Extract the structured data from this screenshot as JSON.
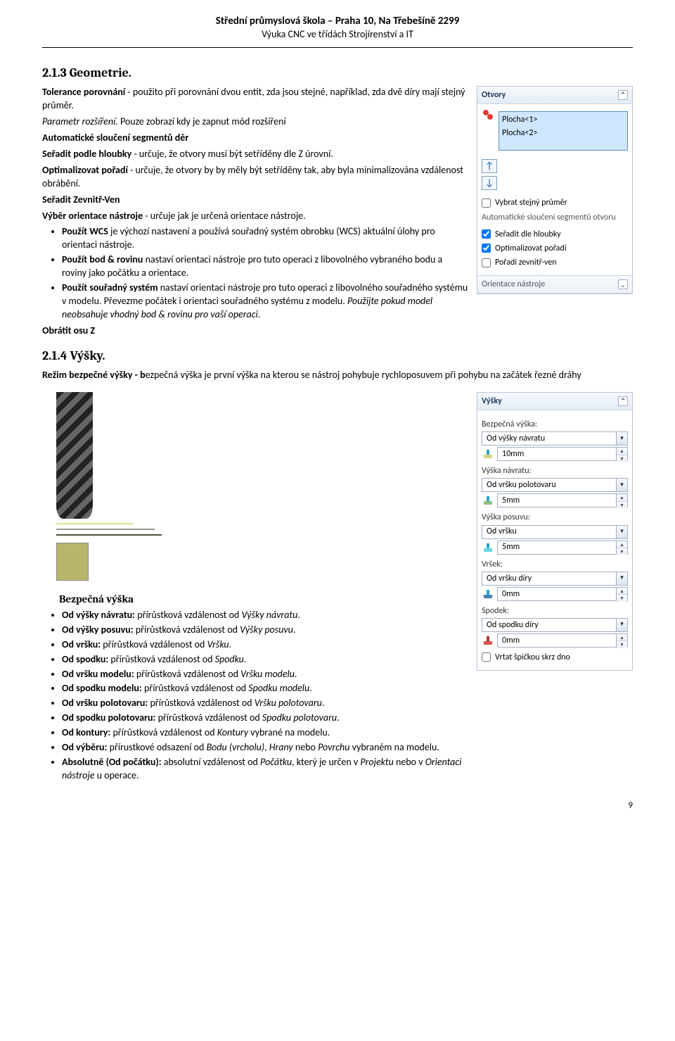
{
  "header": {
    "title": "Střední průmyslová škola – Praha 10, Na Třebešíně 2299",
    "subtitle": "Výuka CNC ve třídách Strojírenství a IT"
  },
  "section1": {
    "num": "2.1.3 Geometrie.",
    "p1a": "Tolerance porovnání",
    "p1b": " - použito při porovnání dvou entit, zda jsou stejné, například, zda dvě díry mají stejný průměr.",
    "p2a": "Parametr rozšíření.",
    "p2b": " Pouze zobrazí kdy je zapnut mód rozšíření",
    "p3": "Automatické sloučení segmentů děr",
    "p4a": "Seřadit podle hloubky",
    "p4b": " - určuje, že otvory musí být setříděny dle Z úrovní.",
    "p5a": "Optimalizovat pořadí",
    "p5b": " - určuje, že otvory by by měly být setříděny tak, aby byla minimalizována vzdálenost obrábění.",
    "p6": "Seřadit Zevnitř-Ven",
    "p7a": "Výběr orientace nástroje",
    "p7b": " - určuje jak je určená orientace nástroje.",
    "li1a": "Použít WCS",
    "li1b": " je výchozí nastavení a používá souřadný systém obrobku (WCS) aktuální úlohy pro orientaci nástroje.",
    "li2a": "Použít bod & rovinu",
    "li2b": " nastaví orientaci nástroje pro tuto operaci z libovolného vybraného bodu a roviny jako počátku a orientace.",
    "li3a": "Použít souřadný systém",
    "li3b": " nastaví orientaci nástroje pro tuto operaci z libovolného souřadného systému v modelu. Převezme počátek i orientaci souřadného systému z modelu. ",
    "li3c": "Použijte pokud model neobsahuje vhodný bod & rovinu pro vaší operaci",
    "li3d": ".",
    "p8": "Obrátit osu Z"
  },
  "panel1": {
    "title": "Otvory",
    "f1": "Plocha<1>",
    "f2": "Plocha<2>",
    "chk1": "Vybrat stejný průměr",
    "lbl1": "Automatické sloučení segmentů otvoru",
    "chk2": "Seřadit dle hloubky",
    "chk3": "Optimalizovat pořadí",
    "chk4": "Pořadí zevnitř-ven",
    "sub": "Orientace nástroje"
  },
  "section2": {
    "num": "2.1.4 Výšky.",
    "p1a": "Režim bezpečné výšky - b",
    "p1b": "ezpečná výška je první výška na kterou se nástroj pohybuje rychloposuvem při pohybu na začátek řezné dráhy",
    "h": "Bezpečná výška",
    "li1a": "Od výšky návratu:",
    "li1b": " přírůstková vzdálenost od ",
    "li1c": "Výšky návratu",
    "li1d": ".",
    "li2a": "Od výšky posuvu:",
    "li2b": " přírůstková vzdálenost od ",
    "li2c": "Výšky posuvu",
    "li2d": ".",
    "li3a": "Od vršku:",
    "li3b": " přírůstková vzdálenost od ",
    "li3c": "Vršku",
    "li3d": ".",
    "li4a": "Od spodku:",
    "li4b": " přírůstková vzdálenost od ",
    "li4c": "Spodku",
    "li4d": ".",
    "li5a": "Od vršku modelu:",
    "li5b": " přírůstková vzdálenost od ",
    "li5c": "Vršku modelu",
    "li5d": ".",
    "li6a": "Od spodku modelu:",
    "li6b": " přírůstková vzdálenost od ",
    "li6c": "Spodku modelu",
    "li6d": ".",
    "li7a": "Od vršku polotovaru:",
    "li7b": " přírůstková vzdálenost od ",
    "li7c": "Vršku polotovaru",
    "li7d": ".",
    "li8a": "Od spodku polotovaru:",
    "li8b": " přírůstková vzdálenost od ",
    "li8c": "Spodku polotovaru",
    "li8d": ".",
    "li9a": "Od kontury:",
    "li9b": " přírůstková vzdálenost od ",
    "li9c": "Kontury",
    "li9d": " vybrané na modelu.",
    "li10a": "Od výběru:",
    "li10b": " přírustkové odsazení od ",
    "li10c": "Bodu (vrcholu)",
    "li10d": ", ",
    "li10e": "Hrany",
    "li10f": " nebo ",
    "li10g": "Povrchu",
    "li10h": " vybraném na modelu.",
    "li11a": "Absolutně (Od počátku):",
    "li11b": " absolutní vzdálenost od ",
    "li11c": "Počátku",
    "li11d": ", který je určen v ",
    "li11e": "Projektu",
    "li11f": " nebo v ",
    "li11g": "Orientaci nástroje",
    "li11h": " u operace."
  },
  "panel2": {
    "title": "Výšky",
    "f1": "Bezpečná výška:",
    "d1": "Od výšky návratu",
    "v1": "10mm",
    "f2": "Výška návratu:",
    "d2": "Od vršku polotovaru",
    "v2": "5mm",
    "f3": "Výška posuvu:",
    "d3": "Od vršku",
    "v3": "5mm",
    "f4": "Vršek:",
    "d4": "Od vršku díry",
    "v4": "0mm",
    "f5": "Spodek:",
    "d5": "Od spodku díry",
    "v5": "0mm",
    "chk": "Vrtat špičkou skrz dno"
  },
  "page_num": "9"
}
